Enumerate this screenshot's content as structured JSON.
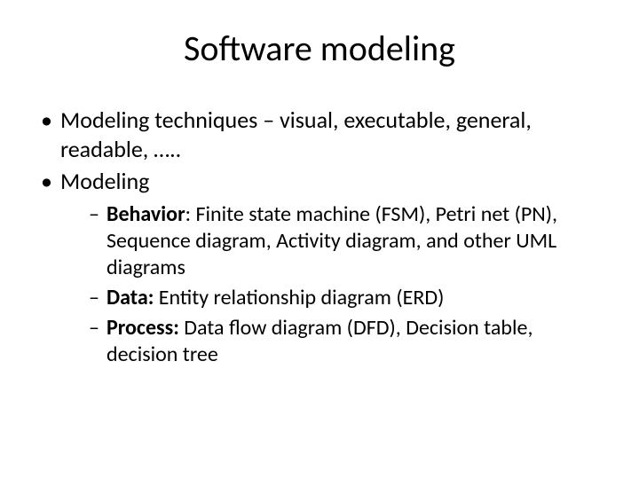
{
  "title": "Software modeling",
  "bullets": [
    {
      "text": "Modeling techniques – visual, executable, general, readable, ….."
    },
    {
      "text": "Modeling",
      "sub": [
        {
          "label": "Behavior",
          "rest": ":  Finite state machine (FSM), Petri net (PN), Sequence diagram, Activity diagram, and other UML diagrams"
        },
        {
          "label": "Data:",
          "rest": " Entity relationship diagram (ERD)"
        },
        {
          "label": "Process:",
          "rest": " Data flow diagram (DFD), Decision table, decision tree"
        }
      ]
    }
  ]
}
